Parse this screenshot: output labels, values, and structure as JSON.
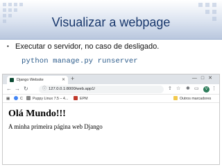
{
  "slide": {
    "title": "Visualizar a webpage",
    "bullet": "Executar o servidor, no caso de desligado.",
    "command": "python manage.py runserver"
  },
  "browser": {
    "tab_title": "Django Website",
    "url": "127.0.0.1:8000/web.app1/",
    "bookmarks": {
      "item1": "C",
      "item2": "Puppy Linux 7.5 – 4...",
      "item3": "EPM",
      "other": "Outros marcadores"
    },
    "avatar_letter": "V",
    "page": {
      "heading": "Olá Mundo!!!",
      "paragraph": "A minha primeira página web Django"
    }
  },
  "colors": {
    "title": "#17366b",
    "command": "#2a5a8a",
    "header_gradient_end": "#b9c7de"
  }
}
